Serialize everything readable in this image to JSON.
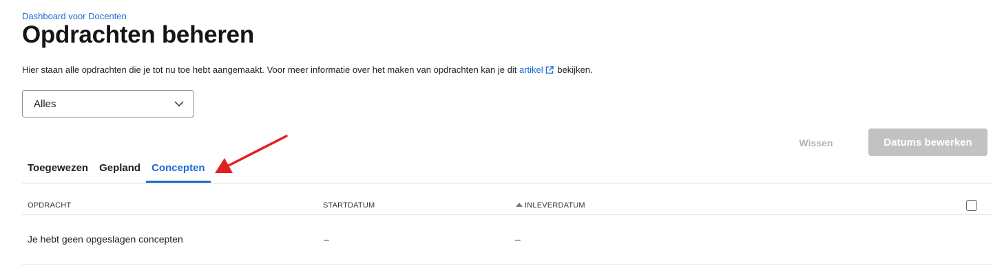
{
  "breadcrumb": "Dashboard voor Docenten",
  "title": "Opdrachten beheren",
  "intro": {
    "text_before": "Hier staan alle opdrachten die je tot nu toe hebt aangemaakt. Voor meer informatie over het maken van opdrachten kan je dit",
    "link_label": "artikel",
    "text_after": "bekijken."
  },
  "filter": {
    "selected": "Alles"
  },
  "actions": {
    "clear_label": "Wissen",
    "edit_dates_label": "Datums bewerken"
  },
  "tabs": [
    {
      "label": "Toegewezen",
      "active": false
    },
    {
      "label": "Gepland",
      "active": false
    },
    {
      "label": "Concepten",
      "active": true
    }
  ],
  "table": {
    "columns": [
      "OPDRACHT",
      "STARTDATUM",
      "INLEVERDATUM"
    ],
    "rows": [
      {
        "opdracht": "Je hebt geen opgeslagen concepten",
        "startdatum": "–",
        "inleverdatum": "–"
      }
    ]
  },
  "colors": {
    "accent": "#1a6ad6",
    "annotation_arrow": "#e02020",
    "disabled_button": "#c2c2c2"
  }
}
